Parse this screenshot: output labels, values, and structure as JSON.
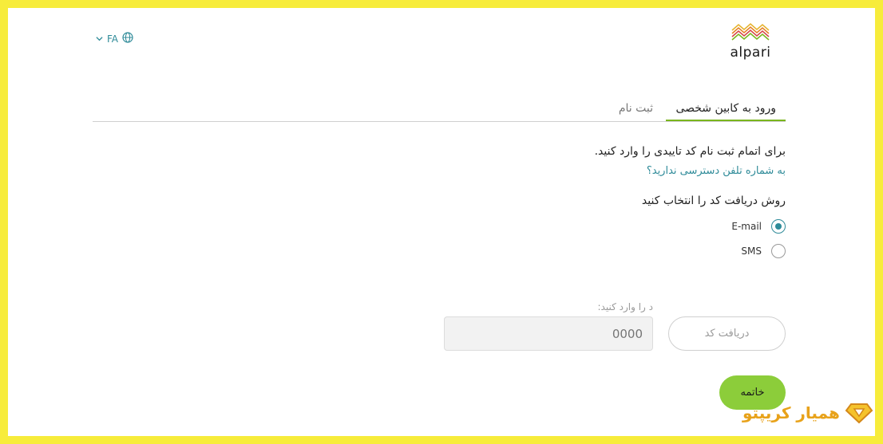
{
  "language": {
    "code": "FA"
  },
  "logo": {
    "text": "alpari"
  },
  "tabs": [
    {
      "label": "ورود به کابین شخصی",
      "active": true
    },
    {
      "label": "ثبت نام",
      "active": false
    }
  ],
  "form": {
    "instruction": "برای اتمام ثبت نام کد تاییدی را وارد کنید.",
    "no_phone_link": "به شماره تلفن دسترسی ندارید؟",
    "method_label": "روش دریافت کد را انتخاب کنید",
    "options": [
      {
        "label": "E-mail",
        "selected": true
      },
      {
        "label": "SMS",
        "selected": false
      }
    ],
    "code_label": "د را وارد کنید:",
    "code_placeholder": "0000",
    "get_code_button": "دریافت کد",
    "finish_button": "خاتمه"
  },
  "watermark": {
    "text": "همیار کریپتو"
  },
  "colors": {
    "accent": "#2f8b99",
    "primary_button": "#8ccd3a",
    "tab_underline": "#7ab51d",
    "frame": "#f7ec3b"
  }
}
